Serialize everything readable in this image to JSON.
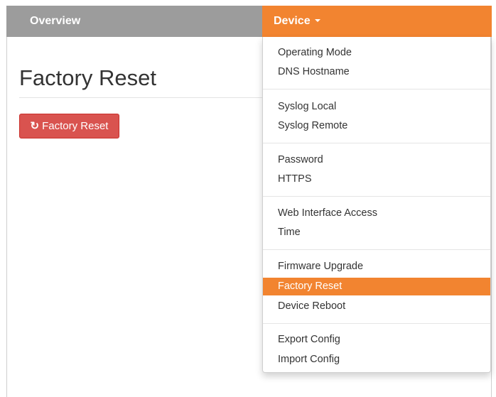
{
  "nav": {
    "overview_label": "Overview",
    "device_label": "Device"
  },
  "page": {
    "title": "Factory Reset",
    "reset_button_label": "Factory Reset",
    "reset_icon": "↻"
  },
  "dropdown": {
    "items": [
      {
        "label": "Operating Mode"
      },
      {
        "label": "DNS Hostname"
      },
      {
        "label": "Syslog Local"
      },
      {
        "label": "Syslog Remote"
      },
      {
        "label": "Password"
      },
      {
        "label": "HTTPS"
      },
      {
        "label": "Web Interface Access"
      },
      {
        "label": "Time"
      },
      {
        "label": "Firmware Upgrade"
      },
      {
        "label": "Factory Reset",
        "active": true
      },
      {
        "label": "Device Reboot"
      },
      {
        "label": "Export Config"
      },
      {
        "label": "Import Config"
      }
    ]
  },
  "colors": {
    "accent": "#f28430",
    "navbar": "#9c9c9c",
    "danger": "#d9534f"
  },
  "icons": {
    "reset": "refresh-icon",
    "caret": "caret-down-icon"
  }
}
